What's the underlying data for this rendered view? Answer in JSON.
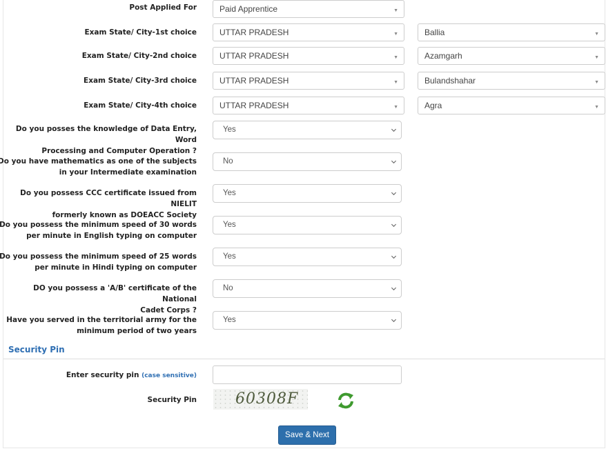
{
  "form": {
    "post_applied_for": {
      "label": "Post Applied For",
      "value": "Paid Apprentice"
    },
    "exam_choices": [
      {
        "label": "Exam State/ City-1st choice",
        "state": "UTTAR PRADESH",
        "city": "Ballia"
      },
      {
        "label": "Exam State/ City-2nd choice",
        "state": "UTTAR PRADESH",
        "city": "Azamgarh"
      },
      {
        "label": "Exam State/ City-3rd choice",
        "state": "UTTAR PRADESH",
        "city": "Bulandshahar"
      },
      {
        "label": "Exam State/ City-4th choice",
        "state": "UTTAR PRADESH",
        "city": "Agra"
      }
    ],
    "questions": [
      {
        "line1": "Do you posses the knowledge of Data Entry, Word",
        "line2": "Processing and Computer Operation ?",
        "value": "Yes"
      },
      {
        "line1": "Do you have mathematics as one of the subjects",
        "line2": "in your Intermediate examination",
        "value": "No"
      },
      {
        "line1": "Do you possess CCC certificate issued from NIELIT",
        "line2": "formerly known as DOEACC Society",
        "value": "Yes"
      },
      {
        "line1": "Do you possess the minimum speed of 30 words",
        "line2": "per minute in English typing on computer",
        "value": "Yes"
      },
      {
        "line1": "Do you possess the minimum speed of 25 words",
        "line2": "per minute in Hindi typing on computer",
        "value": "Yes"
      },
      {
        "line1": "DO you possess a 'A/B' certificate of the National",
        "line2": "Cadet Corps ?",
        "value": "No"
      },
      {
        "line1": "Have you served in the territorial army for the",
        "line2": "minimum period of two years",
        "value": "Yes"
      }
    ]
  },
  "security": {
    "section_title": "Security Pin",
    "enter_label": "Enter security pin",
    "enter_hint": "(case sensitive)",
    "pin_value": "",
    "pin_label": "Security Pin",
    "captcha_code": "60308F",
    "refresh_icon": "refresh-icon"
  },
  "actions": {
    "save_label": "Save & Next",
    "button_color": "#2d6fac"
  }
}
